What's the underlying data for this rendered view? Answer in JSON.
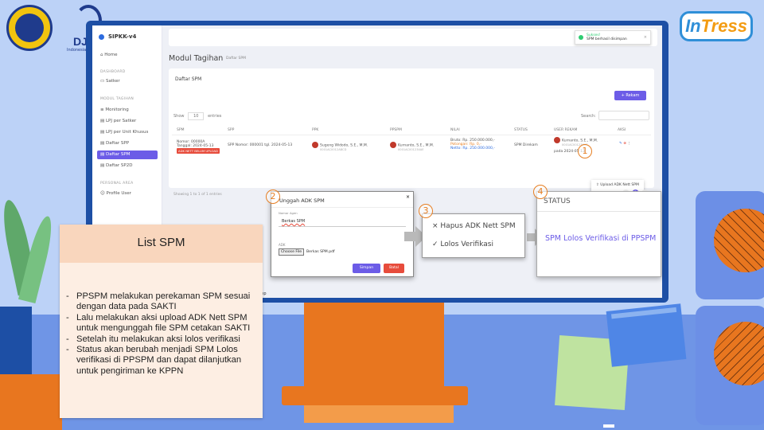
{
  "app": {
    "brand": "SIPKK-v4",
    "logo_text": "DJ",
    "logo_sub": "Indonesia",
    "intress": "InTress"
  },
  "sidebar": {
    "sections": {
      "dashboard": "DASHBOARD",
      "modul": "MODUL TAGIHAN",
      "personal": "PERSONAL AREA"
    },
    "items": [
      {
        "label": "Home"
      },
      {
        "label": "Satker"
      },
      {
        "label": "Monitoring"
      },
      {
        "label": "LPJ per Satker"
      },
      {
        "label": "LPJ per Unit Khusus"
      },
      {
        "label": "Daftar SPP"
      },
      {
        "label": "Daftar SPM"
      },
      {
        "label": "Daftar SP2D"
      },
      {
        "label": "Profile User"
      }
    ]
  },
  "toast": {
    "title": "Sukses!",
    "msg": "SPM berhasil disimpan"
  },
  "page": {
    "title": "Modul Tagihan",
    "crumb": "Daftar SPM"
  },
  "card": {
    "title": "Daftar SPM",
    "rekam": "+ Rekam",
    "show": "Show",
    "show_val": "10",
    "entries": "entries",
    "search": "Search:",
    "columns": [
      "SPM",
      "SPP",
      "PPK",
      "PPSPM",
      "NILAI",
      "STATUS",
      "USER REKAM",
      "AKSI"
    ],
    "row": {
      "spm": "Nomor: 00000A",
      "spm_date": "Tanggal: 2024-05-13",
      "spm_badge": "ADK NETT BELUM UPLOAD",
      "spp": "SPP Nomor: 000001 tgl. 2024-05-13",
      "ppk": "Sugeng Widodo, S.E., M.M.",
      "ppk_sub": "0001AC0012ABCD",
      "ppspm": "Kurnanto, S.E., M.M.",
      "ppspm_sub": "0001AC001234AE",
      "nilai_bruto": "Bruto: Rp. 250.000.000,-",
      "nilai_pot": "Potongan: Rp. 0,-",
      "nilai_netto": "Netto: Rp. 250.000.000,-",
      "status": "SPM Direkam",
      "user": "Kurnanto, S.E., M.M.",
      "user_sub": "0001AC001234AE",
      "user_date": "pada 2024-05-13"
    },
    "info": "Showing 1 to 1 of 1 entries",
    "page_num": "1",
    "menu_item": "Upload ADK Nett SPM"
  },
  "modal": {
    "title": "Unggah ADK SPM",
    "close": "×",
    "lbl_nomor": "Nomor Agen",
    "input_val": "Berkas SPM",
    "lbl_adk": "ADK",
    "choose": "Choose File",
    "file": "Berkas SPM.pdf",
    "save": "Simpan",
    "cancel": "Batal"
  },
  "dropdown": {
    "item1": "Hapus ADK Nett SPM",
    "item2": "Lolos Verifikasi"
  },
  "status_box": {
    "head": "STATUS",
    "value": "SPM Lolos Verifikasi di PPSPM"
  },
  "steps": [
    "1",
    "2",
    "3",
    "4"
  ],
  "panel": {
    "title": "List SPM",
    "items": [
      "PPSPM melakukan perekaman SPM sesuai dengan data pada SAKTI",
      "Lalu melakukan aksi upload ADK Nett SPM untuk mengunggah file SPM cetakan SAKTI",
      "Setelah itu melakukan aksi lolos verifikasi",
      "Status akan berubah menjadi SPM Lolos verifikasi di PPSPM dan dapat dilanjutkan untuk pengiriman ke KPPN"
    ]
  },
  "footer_tag": "ıp"
}
